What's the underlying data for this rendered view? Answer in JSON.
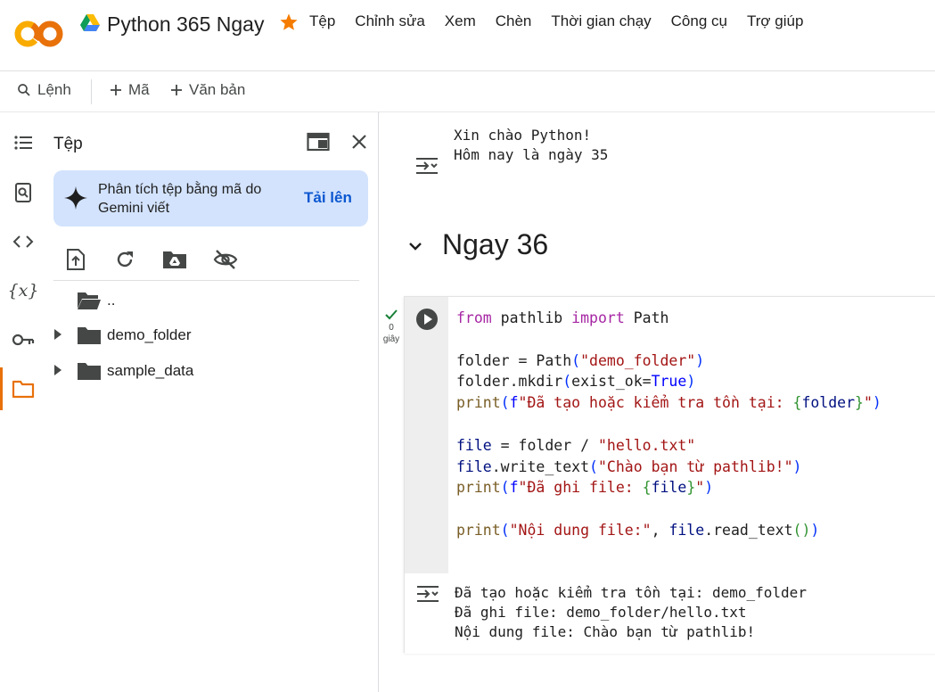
{
  "header": {
    "logo_text": "CO",
    "notebook_title": "Python 365 Ngay",
    "menu": [
      "Tệp",
      "Chỉnh sửa",
      "Xem",
      "Chèn",
      "Thời gian chạy",
      "Công cụ",
      "Trợ giúp"
    ]
  },
  "toolbar": {
    "commands_label": "Lệnh",
    "add_code_label": "Mã",
    "add_text_label": "Văn bản"
  },
  "rail": {
    "items": [
      "toc-icon",
      "find-icon",
      "code-snippets-icon",
      "variables-icon",
      "secrets-key-icon",
      "folder-icon"
    ],
    "variables_glyph": "{x}",
    "active": "folder-icon"
  },
  "files_panel": {
    "title": "Tệp",
    "gemini_prompt": "Phân tích tệp bằng mã do Gemini viết",
    "gemini_action": "Tải lên",
    "tree": [
      {
        "label": "..",
        "expandable": false
      },
      {
        "label": "demo_folder",
        "expandable": true
      },
      {
        "label": "sample_data",
        "expandable": true
      }
    ]
  },
  "notebook": {
    "previous_output": "Xin chào Python!\nHôm nay là ngày 35",
    "section_heading": "Ngay 36",
    "cell": {
      "exec_count": "0",
      "exec_unit": "giây",
      "output": "Đã tạo hoặc kiểm tra tồn tại: demo_folder\nĐã ghi file: demo_folder/hello.txt\nNội dung file: Chào bạn từ pathlib!"
    }
  },
  "colors": {
    "accent_orange": "#e8710a",
    "star": "#f57c00",
    "gemini_bg": "#d3e3fd",
    "link_blue": "#0b57d0",
    "success_green": "#188038"
  }
}
